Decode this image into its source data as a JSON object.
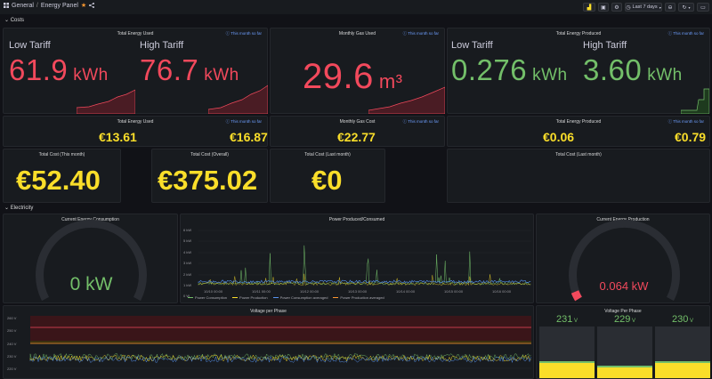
{
  "breadcrumb": {
    "folder": "General",
    "separator": "/",
    "dashboard": "Energy Panel"
  },
  "toolbar": {
    "time_range": "Last 7 days"
  },
  "rows": {
    "costs": "Costs",
    "electricity": "Electricity"
  },
  "panels": {
    "energy_used": {
      "title": "Total Energy Used",
      "link": "This month so far",
      "low_label": "Low Tariff",
      "low_value": "61.9",
      "low_unit": "kWh",
      "high_label": "High Tariff",
      "high_value": "76.7",
      "high_unit": "kWh"
    },
    "gas_used": {
      "title": "Monthly Gas Used",
      "link": "This month so far",
      "value": "29.6",
      "unit": "m³"
    },
    "energy_produced": {
      "title": "Total Energy Produced",
      "link": "This month so far",
      "low_label": "Low Tariff",
      "low_value": "0.276",
      "low_unit": "kWh",
      "high_label": "High Tariff",
      "high_value": "3.60",
      "high_unit": "kWh"
    },
    "energy_used_cost": {
      "title": "Total Energy Used",
      "link": "This month so far",
      "low": "€13.61",
      "high": "€16.87"
    },
    "gas_cost": {
      "title": "Monthly Gas Cost",
      "link": "This month so far",
      "value": "€22.77"
    },
    "energy_produced_cost": {
      "title": "Total Energy Produced",
      "link": "This month so far",
      "low": "€0.06",
      "high": "€0.79"
    },
    "total_cost_month": {
      "title": "Total Cost (This month)",
      "value": "€52.40"
    },
    "total_cost_overall": {
      "title": "Total Cost (Overall)",
      "value": "€375.02"
    },
    "total_cost_last": {
      "title": "Total Cost (Last month)",
      "value": "€0"
    },
    "total_cost_last_empty": {
      "title": "Total Cost (Last month)"
    },
    "current_consumption": {
      "title": "Current Energy Consumption",
      "value": "0 kW",
      "gauge_fraction": 0.0
    },
    "power_chart": {
      "title": "Power Produced/Consumed",
      "y_ticks": [
        "6 kW",
        "5 kW",
        "4 kW",
        "3 kW",
        "2 kW",
        "1 kW",
        "0 W"
      ],
      "x_ticks": [
        "10/10 00:00",
        "10/11 00:00",
        "10/12 00:00",
        "10/13 00:00",
        "10/14 00:00",
        "10/15 00:00",
        "10/16 00:00"
      ],
      "legend": [
        {
          "name": "Power Consumption",
          "color": "#73bf69"
        },
        {
          "name": "Power Production",
          "color": "#fade2a"
        },
        {
          "name": "Power Consumption averaged",
          "color": "#5794f2"
        },
        {
          "name": "Power Production averaged",
          "color": "#ff9830"
        }
      ]
    },
    "current_production": {
      "title": "Current Energy Production",
      "value": "0.064 kW",
      "gauge_fraction": 0.03
    },
    "voltage_chart": {
      "title": "Voltage per Phase",
      "y_ticks": [
        "260 V",
        "250 V",
        "240 V",
        "230 V",
        "220 V"
      ]
    },
    "voltage_bars": {
      "title": "Voltage Per Phase",
      "phases": [
        {
          "value": "231",
          "unit": "V"
        },
        {
          "value": "229",
          "unit": "V"
        },
        {
          "value": "230",
          "unit": "V"
        }
      ]
    }
  },
  "colors": {
    "red": "#f2495c",
    "green": "#73bf69",
    "yellow": "#fade2a",
    "blue": "#5794f2",
    "orange": "#ff9830",
    "panel": "#181b1f",
    "background": "#111217"
  }
}
